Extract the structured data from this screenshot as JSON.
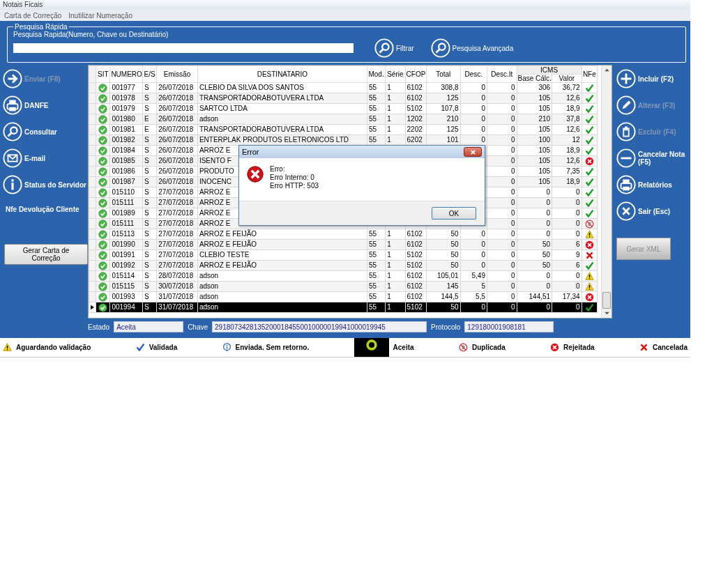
{
  "window": {
    "title": "Notais Ficais"
  },
  "menu": [
    {
      "label": "Carta de Correção"
    },
    {
      "label": "Inutilizar Numeração"
    }
  ],
  "search": {
    "group_title": "Pesquisa Rápida",
    "label": "Pesquisa Rapida(Numero, Chave ou Destinatário)",
    "buttons": [
      {
        "label": "Filtrar"
      },
      {
        "label": "Pesquisa Avançada"
      }
    ]
  },
  "left_actions": [
    {
      "label": "Enviar   (F8)",
      "kind": "arrow",
      "disabled": true
    },
    {
      "label": "DANFE",
      "kind": "printer",
      "disabled": false
    },
    {
      "label": "Consultar",
      "kind": "search",
      "disabled": false
    },
    {
      "label": "E-mail",
      "kind": "mail",
      "disabled": false
    },
    {
      "label": "Status do Servidor",
      "kind": "info",
      "disabled": false
    }
  ],
  "left_link": "Nfe Devolução Cliente",
  "left_button": "Gerar Carta de Correção",
  "table": {
    "columns": [
      {
        "label": "SIT"
      },
      {
        "label": "NUMERO"
      },
      {
        "label": "E/S"
      },
      {
        "label": "Emissão"
      },
      {
        "label": "DESTINATARIO"
      },
      {
        "label": "Mod."
      },
      {
        "label": "Série"
      },
      {
        "label": "CFOP"
      },
      {
        "label": "Total"
      },
      {
        "label": "Desc."
      },
      {
        "label": "Desc.It"
      },
      {
        "label": "ICMS",
        "children": [
          {
            "label": "Base Cálc."
          },
          {
            "label": "Valor"
          }
        ]
      },
      {
        "label": "NFe"
      }
    ],
    "rows": [
      {
        "nfe": {
          "kind": "ok"
        },
        "numero": "001977",
        "es": "S",
        "emissao": "26/07/2018",
        "destinatario": "CLEBIO DA SILVA DOS SANTOS",
        "mod": "55",
        "serie": "1",
        "cfop": "6102",
        "total": "308,8",
        "desc": "0",
        "desc_it": "0",
        "base": "306",
        "valor": "36,72",
        "selected": false
      },
      {
        "numero": "001978",
        "es": "S",
        "emissao": "26/07/2018",
        "destinatario": "TRANSPORTADORABOTUVERA LTDA",
        "mod": "55",
        "serie": "1",
        "cfop": "6102",
        "total": "125",
        "desc": "0",
        "desc_it": "0",
        "base": "105",
        "valor": "12,6",
        "nfe": {
          "kind": "ok"
        },
        "selected": false
      },
      {
        "numero": "001979",
        "es": "S",
        "emissao": "26/07/2018",
        "destinatario": "SARTCO LTDA",
        "mod": "55",
        "serie": "1",
        "cfop": "5102",
        "total": "107,8",
        "desc": "0",
        "desc_it": "0",
        "base": "105",
        "valor": "18,9",
        "nfe": {
          "kind": "ok"
        },
        "selected": false
      },
      {
        "numero": "001980",
        "es": "E",
        "emissao": "26/07/2018",
        "destinatario": "adson",
        "mod": "55",
        "serie": "1",
        "cfop": "1202",
        "total": "210",
        "desc": "0",
        "desc_it": "0",
        "base": "210",
        "valor": "37,8",
        "nfe": {
          "kind": "ok"
        },
        "selected": false
      },
      {
        "numero": "001981",
        "es": "E",
        "emissao": "26/07/2018",
        "destinatario": "TRANSPORTADORABOTUVERA LTDA",
        "mod": "55",
        "serie": "1",
        "cfop": "2202",
        "total": "125",
        "desc": "0",
        "desc_it": "0",
        "base": "105",
        "valor": "12,6",
        "nfe": {
          "kind": "ok"
        },
        "selected": false
      },
      {
        "numero": "001982",
        "es": "S",
        "emissao": "26/07/2018",
        "destinatario": "ENTERPLAK PRODUTOS ELETRONICOS LTD",
        "mod": "55",
        "serie": "1",
        "cfop": "6202",
        "total": "101",
        "desc": "0",
        "desc_it": "0",
        "base": "100",
        "valor": "12",
        "nfe": {
          "kind": "ok"
        },
        "selected": false
      },
      {
        "numero": "001984",
        "es": "S",
        "emissao": "26/07/2018",
        "destinatario": "ARROZ E",
        "desc_it": "0",
        "base": "105",
        "valor": "18,9",
        "nfe": {
          "kind": "ok"
        },
        "selected": false
      },
      {
        "numero": "001985",
        "es": "S",
        "emissao": "26/07/2018",
        "destinatario": "ISENTO F",
        "desc_it": "0",
        "base": "105",
        "valor": "12,6",
        "nfe": {
          "kind": "rejected"
        },
        "selected": false
      },
      {
        "numero": "001986",
        "es": "S",
        "emissao": "26/07/2018",
        "destinatario": "PRODUTO",
        "desc_it": "0",
        "base": "105",
        "valor": "7,35",
        "nfe": {
          "kind": "ok"
        },
        "selected": false
      },
      {
        "numero": "001987",
        "es": "S",
        "emissao": "26/07/2018",
        "destinatario": "INOCENC",
        "desc_it": "0",
        "base": "105",
        "valor": "18,9",
        "nfe": {
          "kind": "ok"
        },
        "selected": false
      },
      {
        "numero": "015110",
        "es": "S",
        "emissao": "27/07/2018",
        "destinatario": "ARROZ E",
        "desc_it": "0",
        "base": "0",
        "valor": "0",
        "nfe": {
          "kind": "ok"
        },
        "selected": false
      },
      {
        "numero": "015111",
        "es": "S",
        "emissao": "27/07/2018",
        "destinatario": "ARROZ E",
        "desc_it": "0",
        "base": "0",
        "valor": "0",
        "nfe": {
          "kind": "ok"
        },
        "selected": false
      },
      {
        "numero": "001989",
        "es": "S",
        "emissao": "27/07/2018",
        "destinatario": "ARROZ E",
        "desc_it": "0",
        "base": "0",
        "valor": "0",
        "nfe": {
          "kind": "ok"
        },
        "selected": false
      },
      {
        "numero": "015111",
        "es": "S",
        "emissao": "27/07/2018",
        "destinatario": "ARROZ E",
        "desc_it": "0",
        "base": "0",
        "valor": "0",
        "nfe": {
          "kind": "duplicate"
        },
        "selected": false
      },
      {
        "numero": "015113",
        "es": "S",
        "emissao": "27/07/2018",
        "destinatario": "ARROZ E FEIJÃO",
        "mod": "55",
        "serie": "1",
        "cfop": "6102",
        "total": "50",
        "desc": "0",
        "desc_it": "0",
        "base": "0",
        "valor": "0",
        "nfe": {
          "kind": "warning"
        },
        "selected": false
      },
      {
        "numero": "001990",
        "es": "S",
        "emissao": "27/07/2018",
        "destinatario": "ARROZ E FEIJÃO",
        "mod": "55",
        "serie": "1",
        "cfop": "6102",
        "total": "50",
        "desc": "0",
        "desc_it": "0",
        "base": "50",
        "valor": "6",
        "nfe": {
          "kind": "rejected"
        },
        "selected": false
      },
      {
        "numero": "001991",
        "es": "S",
        "emissao": "27/07/2018",
        "destinatario": "CLEBIO TESTE",
        "mod": "55",
        "serie": "1",
        "cfop": "5102",
        "total": "50",
        "desc": "0",
        "desc_it": "0",
        "base": "50",
        "valor": "9",
        "nfe": {
          "kind": "cancelled"
        },
        "selected": false
      },
      {
        "numero": "001992",
        "es": "S",
        "emissao": "27/07/2018",
        "destinatario": "ARROZ E FEIJÃO",
        "mod": "55",
        "serie": "1",
        "cfop": "5102",
        "total": "50",
        "desc": "0",
        "desc_it": "0",
        "base": "50",
        "valor": "6",
        "nfe": {
          "kind": "ok"
        },
        "selected": false
      },
      {
        "numero": "015114",
        "es": "S",
        "emissao": "28/07/2018",
        "destinatario": "adson",
        "mod": "55",
        "serie": "1",
        "cfop": "6102",
        "total": "105,01",
        "desc": "5,49",
        "desc_it": "0",
        "base": "0",
        "valor": "0",
        "nfe": {
          "kind": "warning"
        },
        "selected": false
      },
      {
        "numero": "015115",
        "es": "S",
        "emissao": "30/07/2018",
        "destinatario": "adson",
        "mod": "55",
        "serie": "1",
        "cfop": "6102",
        "total": "145",
        "desc": "5",
        "desc_it": "0",
        "base": "0",
        "valor": "0",
        "nfe": {
          "kind": "warning"
        },
        "selected": false
      },
      {
        "numero": "001993",
        "es": "S",
        "emissao": "31/07/2018",
        "destinatario": "adson",
        "mod": "55",
        "serie": "1",
        "cfop": "6102",
        "total": "144,5",
        "desc": "5,5",
        "desc_it": "0",
        "base": "144,51",
        "valor": "17,34",
        "nfe": {
          "kind": "rejected"
        },
        "selected": false
      },
      {
        "numero": "001994",
        "es": "S",
        "emissao": "31/07/2018",
        "destinatario": "adson",
        "mod": "55",
        "serie": "1",
        "cfop": "5102",
        "total": "50",
        "desc": "0",
        "desc_it": "0",
        "base": "0",
        "valor": "0",
        "nfe": {
          "kind": "ok"
        },
        "selected": true
      }
    ]
  },
  "fields": [
    {
      "label": "Estado",
      "value": "Aceita"
    },
    {
      "label": "Chave",
      "value": "29180734281352000184550010000019941000019945"
    },
    {
      "label": "Protocolo",
      "value": "129180001908181"
    }
  ],
  "right_actions": [
    {
      "label": "Incluir (F2)",
      "kind": "plus",
      "disabled": false
    },
    {
      "label": "Alterar  (F3)",
      "kind": "pencil",
      "disabled": true
    },
    {
      "label": "Excluir  (F4)",
      "kind": "trash",
      "disabled": true
    },
    {
      "label": "Cancelar Nota (F5)",
      "kind": "minus",
      "disabled": false
    },
    {
      "label": "Relatórios",
      "kind": "printer",
      "disabled": false
    },
    {
      "label": "Sair  (Esc)",
      "kind": "close",
      "disabled": false
    }
  ],
  "right_button": {
    "label": "Gerar XML",
    "disabled": true
  },
  "dialog": {
    "title": "Error",
    "lines": [
      "Erro:",
      "Erro Interno: 0",
      "Erro HTTP: 503"
    ],
    "button": "OK"
  },
  "legend": [
    {
      "label": "Aguardando validação",
      "kind": "warning"
    },
    {
      "label": "Validada",
      "kind": "validated"
    },
    {
      "label": "Enviada. Sem retorno.",
      "kind": "sent"
    },
    {
      "label": "Aceita",
      "kind": "accepted"
    },
    {
      "label": "Duplicada",
      "kind": "duplicate"
    },
    {
      "label": "Rejeitada",
      "kind": "rejected"
    },
    {
      "label": "Cancelada",
      "kind": "cancelled"
    }
  ]
}
